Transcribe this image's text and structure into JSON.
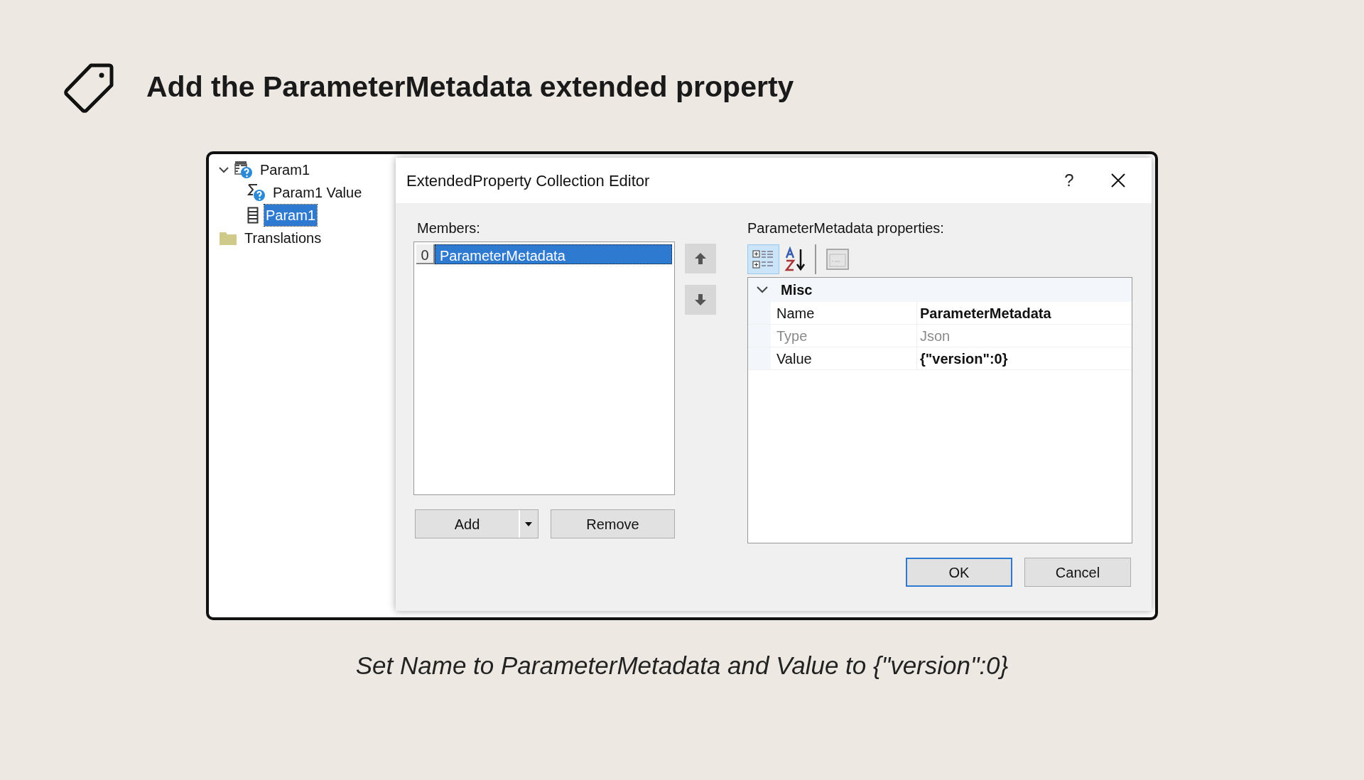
{
  "heading": {
    "title": "Add the ParameterMetadata extended property"
  },
  "tree": {
    "items": [
      {
        "label": "Param1",
        "kind": "parameter",
        "expanded": true,
        "selected": false,
        "children": [
          {
            "label": "Param1 Value",
            "kind": "value",
            "selected": false
          },
          {
            "label": "Param1",
            "kind": "table",
            "selected": true
          }
        ]
      },
      {
        "label": "Translations",
        "kind": "folder",
        "selected": false
      }
    ]
  },
  "dialog": {
    "title": "ExtendedProperty Collection Editor",
    "help": "?",
    "members_label": "Members:",
    "members": [
      {
        "index": "0",
        "label": "ParameterMetadata",
        "selected": true
      }
    ],
    "add_button": "Add",
    "remove_button": "Remove",
    "properties_label": "ParameterMetadata properties:",
    "categorized": true,
    "category": {
      "label": "Misc",
      "expanded": true
    },
    "properties": [
      {
        "name": "Name",
        "value": "ParameterMetadata",
        "readonly": false,
        "selected": false
      },
      {
        "name": "Type",
        "value": "Json",
        "readonly": true,
        "selected": false
      },
      {
        "name": "Value",
        "value": "{\"version\":0}",
        "readonly": false,
        "selected": false
      }
    ],
    "buttons": [
      {
        "label": "OK",
        "default": true
      },
      {
        "label": "Cancel",
        "default": false
      }
    ]
  },
  "caption": "Set Name to ParameterMetadata and Value to {\"version\":0}"
}
